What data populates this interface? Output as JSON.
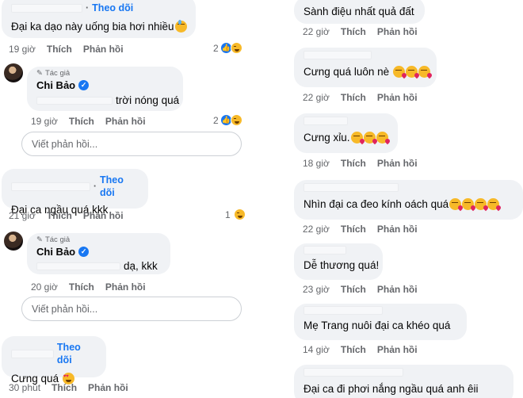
{
  "actions": {
    "like": "Thích",
    "reply": "Phản hồi",
    "follow": "Theo dõi",
    "reply_placeholder": "Viết phản hồi..."
  },
  "left": {
    "c1": {
      "text": "Đại ka dạo này uống bia hơi nhiều",
      "time": "19 giờ",
      "reactions": "2"
    },
    "r1": {
      "tag": "Tác giả",
      "author": "Chi Bảo",
      "text": "trời nóng quá",
      "time": "19 giờ",
      "reactions": "2"
    },
    "c2": {
      "text": "Đại ca ngầu quá kkk",
      "time": "21 giờ",
      "reactions": "1"
    },
    "r2": {
      "tag": "Tác giả",
      "author": "Chi Bảo",
      "text": "dạ, kkk",
      "time": "20 giờ"
    },
    "c3": {
      "text": "Cưng quá",
      "time": "30 phút"
    }
  },
  "right": {
    "c1": {
      "text": "Sành điệu nhất quả đất",
      "time": "22 giờ"
    },
    "c2": {
      "text": "Cưng quá luôn nè",
      "time": "22 giờ"
    },
    "c3": {
      "text": "Cưng xỉu.",
      "time": "18 giờ"
    },
    "c4": {
      "text": "Nhìn đại ca đeo kính oách quá",
      "time": "22 giờ"
    },
    "c5": {
      "text": "Dễ thương quá!",
      "time": "23 giờ"
    },
    "c6": {
      "text": "Mẹ Trang nuôi đại ca khéo quá",
      "time": "14 giờ"
    },
    "c7": {
      "text": "Đại ca đi phơi nắng ngầu quá anh êii"
    }
  },
  "icons": {
    "like": "like-reaction-icon",
    "haha": "haha-reaction-icon",
    "verified": "verified-badge-icon",
    "pen": "pen-icon"
  },
  "colors": {
    "accent": "#1877f2",
    "bubble": "#f0f2f5",
    "muted": "#65676b"
  }
}
